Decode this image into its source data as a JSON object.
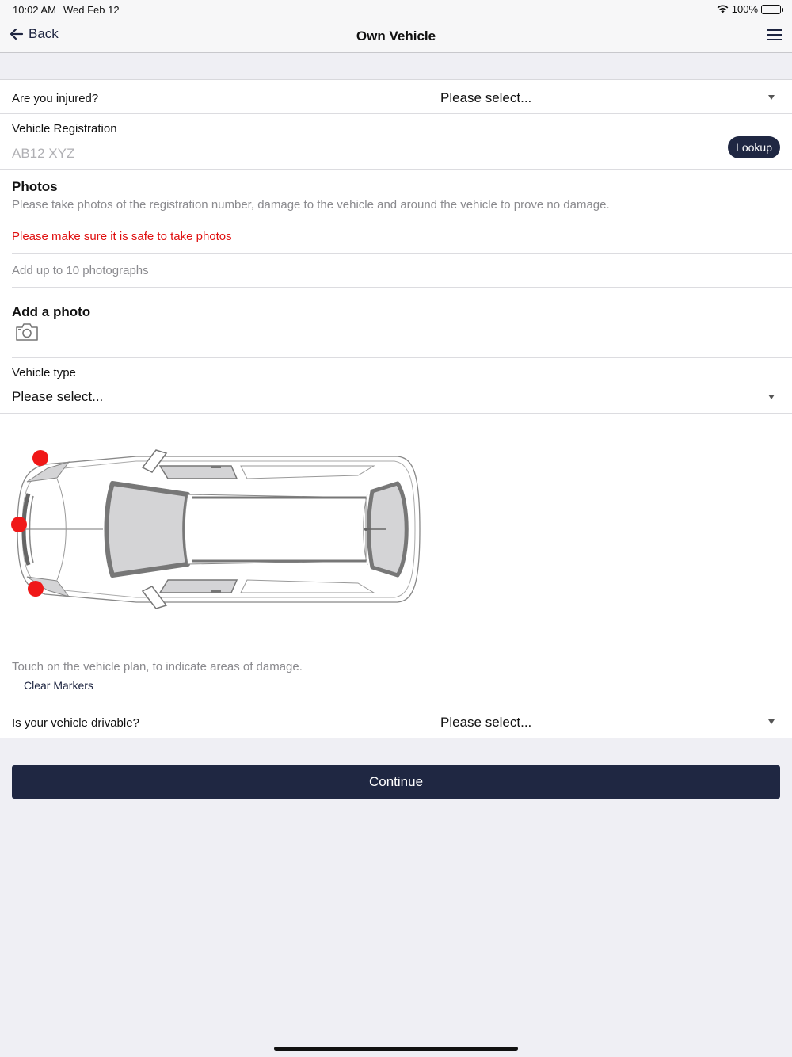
{
  "status_bar": {
    "time": "10:02 AM",
    "date": "Wed Feb 12",
    "battery": "100%",
    "icons": [
      "wifi-icon",
      "battery-icon"
    ]
  },
  "nav": {
    "back_label": "Back",
    "title": "Own Vehicle",
    "icons": [
      "arrow-left-icon",
      "hamburger-menu-icon"
    ]
  },
  "form": {
    "injured": {
      "label": "Are you injured?",
      "value": "Please select..."
    },
    "registration": {
      "label": "Vehicle Registration",
      "placeholder": "AB12 XYZ",
      "lookup_label": "Lookup"
    },
    "photos": {
      "heading": "Photos",
      "description": "Please take photos of the registration number, damage to the vehicle and around the vehicle to prove no damage.",
      "warning": "Please make sure it is safe to take photos",
      "limit": "Add up to 10 photographs"
    },
    "add_photo": {
      "heading": "Add a photo",
      "icon": "camera-icon"
    },
    "vehicle_type": {
      "label": "Vehicle type",
      "value": "Please select..."
    },
    "vehicle_plan": {
      "hint": "Touch on the vehicle plan, to indicate areas of damage.",
      "clear_label": "Clear Markers",
      "marker_color": "#f01818",
      "marker_count": 3
    },
    "drivable": {
      "label": "Is your vehicle drivable?",
      "value": "Please select..."
    }
  },
  "continue_label": "Continue",
  "colors": {
    "primary": "#1f2742",
    "warning": "#e01010",
    "background": "#efeff4"
  }
}
